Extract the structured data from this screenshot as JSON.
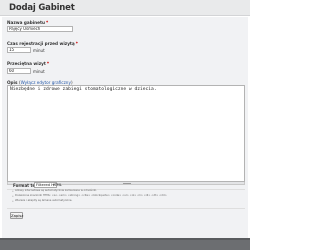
{
  "page": {
    "title": "Dodaj Gabinet"
  },
  "form": {
    "name": {
      "label": "Nazwa gabinetu",
      "required": "*",
      "value": "Pajęcy Uśmiech"
    },
    "registration": {
      "label": "Czas rejestracji przed wizytą",
      "required": "*",
      "value": "15",
      "unit": "minut"
    },
    "duration": {
      "label": "Przeciętna wizyt",
      "required": "*",
      "value": "60",
      "unit": "minut"
    },
    "description": {
      "label": "Opis",
      "link_prefix": "(",
      "link": "Wyłącz edytor graficzny",
      "link_suffix": ")",
      "value": "Niezbędne i zdrowe zabiegi stomatologiczne w dziecia."
    },
    "text_format": {
      "label": "Format tekstu:",
      "selected": "Filtered HTML"
    },
    "tips": [
      "Adresy internetowe są automatycznie zamieniane w odnośniki.",
      "Dozwolone znaczniki HTML: <a> <em> <strong> <cite> <blockquote> <code> <ul> <ol> <li> <dl> <dt> <dd>",
      "Wiersze i akapity są łamane automatycznie."
    ],
    "submit_label": "Zapisz"
  }
}
